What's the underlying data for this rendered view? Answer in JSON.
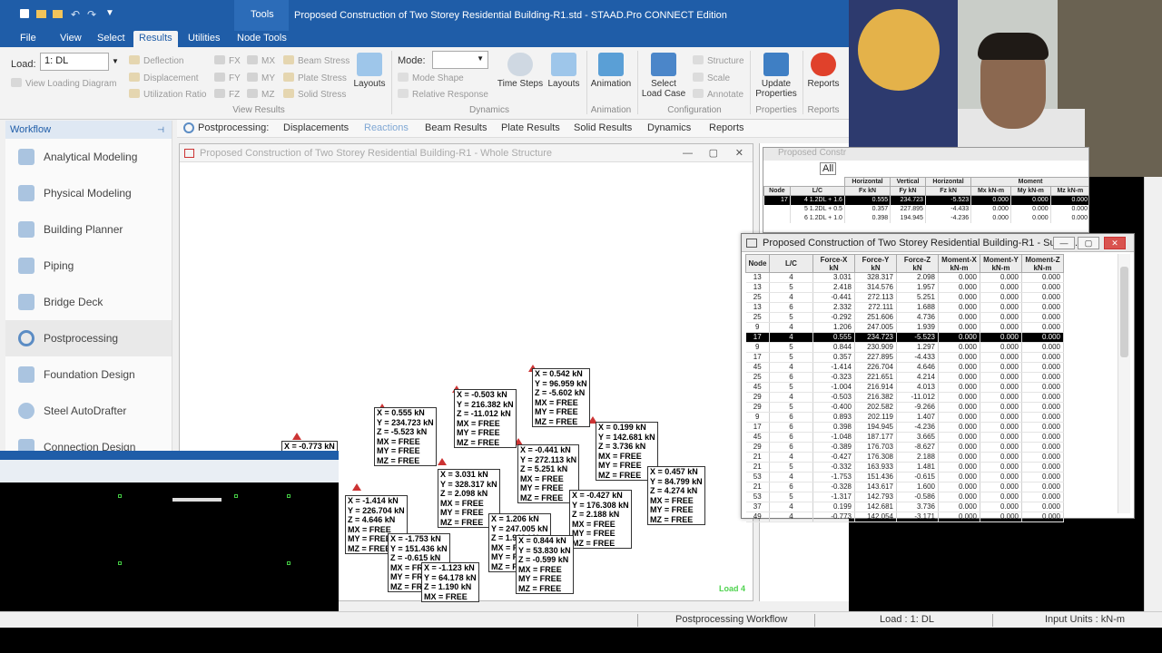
{
  "app": {
    "tools_tab": "Tools",
    "title": "Proposed Construction of Two Storey Residential Building-R1.std - STAAD.Pro CONNECT Edition"
  },
  "tabs": [
    "File",
    "View",
    "Select",
    "Results",
    "Utilities",
    "Node Tools"
  ],
  "ribbon": {
    "load_label": "Load:",
    "load_value": "1: DL",
    "view_loading_diagram": "View Loading Diagram",
    "deflection": "Deflection",
    "displacement": "Displacement",
    "utilization_ratio": "Utilization Ratio",
    "fx": "FX",
    "fy": "FY",
    "fz": "FZ",
    "mx": "MX",
    "my": "MY",
    "mz": "MZ",
    "beam_stress": "Beam Stress",
    "plate_stress": "Plate Stress",
    "solid_stress": "Solid Stress",
    "layouts": "Layouts",
    "view_results_group": "View Results",
    "mode_label": "Mode:",
    "mode_shape": "Mode Shape",
    "relative_response": "Relative Response",
    "time_steps": "Time Steps",
    "layouts2": "Layouts",
    "dynamics_group": "Dynamics",
    "animation": "Animation",
    "animation_group": "Animation",
    "select_load_case": "Select Load Case",
    "structure": "Structure",
    "scale": "Scale",
    "annotate": "Annotate",
    "configuration_group": "Configuration",
    "update_properties": "Update Properties",
    "properties_group": "Properties",
    "reports": "Reports",
    "reports_group": "Reports"
  },
  "workflow": {
    "title": "Workflow",
    "items": [
      "Analytical Modeling",
      "Physical Modeling",
      "Building Planner",
      "Piping",
      "Bridge Deck",
      "Postprocessing",
      "Foundation Design",
      "Steel AutoDrafter",
      "Connection Design"
    ]
  },
  "subtabs": {
    "lead": "Postprocessing:",
    "items": [
      "Displacements",
      "Reactions",
      "Beam Results",
      "Plate Results",
      "Solid Results",
      "Dynamics",
      "Reports"
    ]
  },
  "view_window": {
    "title": "Proposed Construction of Two Storey Residential Building-R1 - Whole Structure",
    "load_tag": "Load 4"
  },
  "reaction_labels": [
    [
      "X = 0.542 kN",
      "Y = 96.959 kN",
      "Z = -5.602 kN",
      "MX = FREE",
      "MY = FREE",
      "MZ = FREE"
    ],
    [
      "X = -0.503 kN",
      "Y = 216.382 kN",
      "Z = -11.012 kN",
      "MX = FREE",
      "MY = FREE",
      "MZ = FREE"
    ],
    [
      "X = 0.555 kN",
      "Y = 234.723 kN",
      "Z = -5.523 kN",
      "MX = FREE",
      "MY = FREE",
      "MZ = FREE"
    ],
    [
      "X = 0.199 kN",
      "Y = 142.681 kN",
      "Z = 3.736 kN",
      "MX = FREE",
      "MY = FREE",
      "MZ = FREE"
    ],
    [
      "X = -0.441 kN",
      "Y = 272.113 kN",
      "Z = 5.251 kN",
      "MX = FREE",
      "MY = FREE",
      "MZ = FREE"
    ],
    [
      "X = 0.457 kN",
      "Y = 84.799 kN",
      "Z = 4.274 kN",
      "MX = FREE",
      "MY = FREE",
      "MZ = FREE"
    ],
    [
      "X = 3.031 kN",
      "Y = 328.317 kN",
      "Z = 2.098 kN",
      "MX = FREE",
      "MY = FREE",
      "MZ = FREE"
    ],
    [
      "X = -0.427 kN",
      "Y = 176.308 kN",
      "Z = 2.188 kN",
      "MX = FREE",
      "MY = FREE",
      "MZ = FREE"
    ],
    [
      "X = -1.414 kN",
      "Y = 226.704 kN",
      "Z = 4.646 kN",
      "MX = FREE",
      "MY = FREE",
      "MZ = FREE"
    ],
    [
      "X = 1.206 kN",
      "Y = 247.005 kN",
      "Z = 1.939 kN",
      "MX = FREE",
      "MY = FREE",
      "MZ = FREE"
    ],
    [
      "X = -1.753 kN",
      "Y = 151.436 kN",
      "Z = -0.615 kN",
      "MX = FREE",
      "MY = FREE",
      "MZ = FREE"
    ],
    [
      "X = 0.844 kN",
      "Y = 53.830 kN",
      "Z = -0.599 kN",
      "MX = FREE",
      "MY = FREE",
      "MZ = FREE"
    ],
    [
      "X = -1.123 kN",
      "Y = 64.178 kN",
      "Z = 1.190 kN",
      "MX = FREE"
    ],
    [
      "X = -0.773 kN"
    ]
  ],
  "bg_table": {
    "title": "Proposed Constr",
    "tab": "All",
    "group_headers": [
      "Horizontal",
      "Vertical",
      "Horizontal",
      "Moment"
    ],
    "headers": [
      "Node",
      "L/C",
      "Fx kN",
      "Fy kN",
      "Fz kN",
      "Mx kN-m",
      "My kN-m",
      "Mz kN-m"
    ],
    "rows": [
      [
        "17",
        "4 1.2DL + 1.6",
        "0.555",
        "234.723",
        "-5.523",
        "0.000",
        "0.000",
        "0.000"
      ],
      [
        "",
        "5 1.2DL + 0.5",
        "0.357",
        "227.895",
        "-4.433",
        "0.000",
        "0.000",
        "0.000"
      ],
      [
        "",
        "6 1.2DL + 1.0",
        "0.398",
        "194.945",
        "-4.236",
        "0.000",
        "0.000",
        "0.000"
      ]
    ]
  },
  "support_window": {
    "title": "Proposed Construction of Two Storey Residential Building-R1 - Suppo...",
    "headers": [
      "Node",
      "L/C",
      "Force-X kN",
      "Force-Y kN",
      "Force-Z kN",
      "Moment-X kN-m",
      "Moment-Y kN-m",
      "Moment-Z kN-m"
    ],
    "rows": [
      [
        "13",
        "4",
        "3.031",
        "328.317",
        "2.098",
        "0.000",
        "0.000",
        "0.000"
      ],
      [
        "13",
        "5",
        "2.418",
        "314.576",
        "1.957",
        "0.000",
        "0.000",
        "0.000"
      ],
      [
        "25",
        "4",
        "-0.441",
        "272.113",
        "5.251",
        "0.000",
        "0.000",
        "0.000"
      ],
      [
        "13",
        "6",
        "2.332",
        "272.111",
        "1.688",
        "0.000",
        "0.000",
        "0.000"
      ],
      [
        "25",
        "5",
        "-0.292",
        "251.606",
        "4.736",
        "0.000",
        "0.000",
        "0.000"
      ],
      [
        "9",
        "4",
        "1.206",
        "247.005",
        "1.939",
        "0.000",
        "0.000",
        "0.000"
      ],
      [
        "17",
        "4",
        "0.555",
        "234.723",
        "-5.523",
        "0.000",
        "0.000",
        "0.000"
      ],
      [
        "9",
        "5",
        "0.844",
        "230.909",
        "1.297",
        "0.000",
        "0.000",
        "0.000"
      ],
      [
        "17",
        "5",
        "0.357",
        "227.895",
        "-4.433",
        "0.000",
        "0.000",
        "0.000"
      ],
      [
        "45",
        "4",
        "-1.414",
        "226.704",
        "4.646",
        "0.000",
        "0.000",
        "0.000"
      ],
      [
        "25",
        "6",
        "-0.323",
        "221.651",
        "4.214",
        "0.000",
        "0.000",
        "0.000"
      ],
      [
        "45",
        "5",
        "-1.004",
        "216.914",
        "4.013",
        "0.000",
        "0.000",
        "0.000"
      ],
      [
        "29",
        "4",
        "-0.503",
        "216.382",
        "-11.012",
        "0.000",
        "0.000",
        "0.000"
      ],
      [
        "29",
        "5",
        "-0.400",
        "202.582",
        "-9.266",
        "0.000",
        "0.000",
        "0.000"
      ],
      [
        "9",
        "6",
        "0.893",
        "202.119",
        "1.407",
        "0.000",
        "0.000",
        "0.000"
      ],
      [
        "17",
        "6",
        "0.398",
        "194.945",
        "-4.236",
        "0.000",
        "0.000",
        "0.000"
      ],
      [
        "45",
        "6",
        "-1.048",
        "187.177",
        "3.665",
        "0.000",
        "0.000",
        "0.000"
      ],
      [
        "29",
        "6",
        "-0.389",
        "176.703",
        "-8.627",
        "0.000",
        "0.000",
        "0.000"
      ],
      [
        "21",
        "4",
        "-0.427",
        "176.308",
        "2.188",
        "0.000",
        "0.000",
        "0.000"
      ],
      [
        "21",
        "5",
        "-0.332",
        "163.933",
        "1.481",
        "0.000",
        "0.000",
        "0.000"
      ],
      [
        "53",
        "4",
        "-1.753",
        "151.436",
        "-0.615",
        "0.000",
        "0.000",
        "0.000"
      ],
      [
        "21",
        "6",
        "-0.328",
        "143.617",
        "1.600",
        "0.000",
        "0.000",
        "0.000"
      ],
      [
        "53",
        "5",
        "-1.317",
        "142.793",
        "-0.586",
        "0.000",
        "0.000",
        "0.000"
      ],
      [
        "37",
        "4",
        "0.199",
        "142.681",
        "3.736",
        "0.000",
        "0.000",
        "0.000"
      ],
      [
        "49",
        "4",
        "-0.773",
        "142.054",
        "-3.171",
        "0.000",
        "0.000",
        "0.000"
      ]
    ],
    "highlight_row": 6
  },
  "status": {
    "workflow": "Postprocessing Workflow",
    "load": "Load : 1: DL",
    "units": "Input Units : kN-m"
  },
  "colors": {
    "brand": "#1f5da8",
    "highlight": "#000000",
    "load_tag": "#4fd34f"
  }
}
